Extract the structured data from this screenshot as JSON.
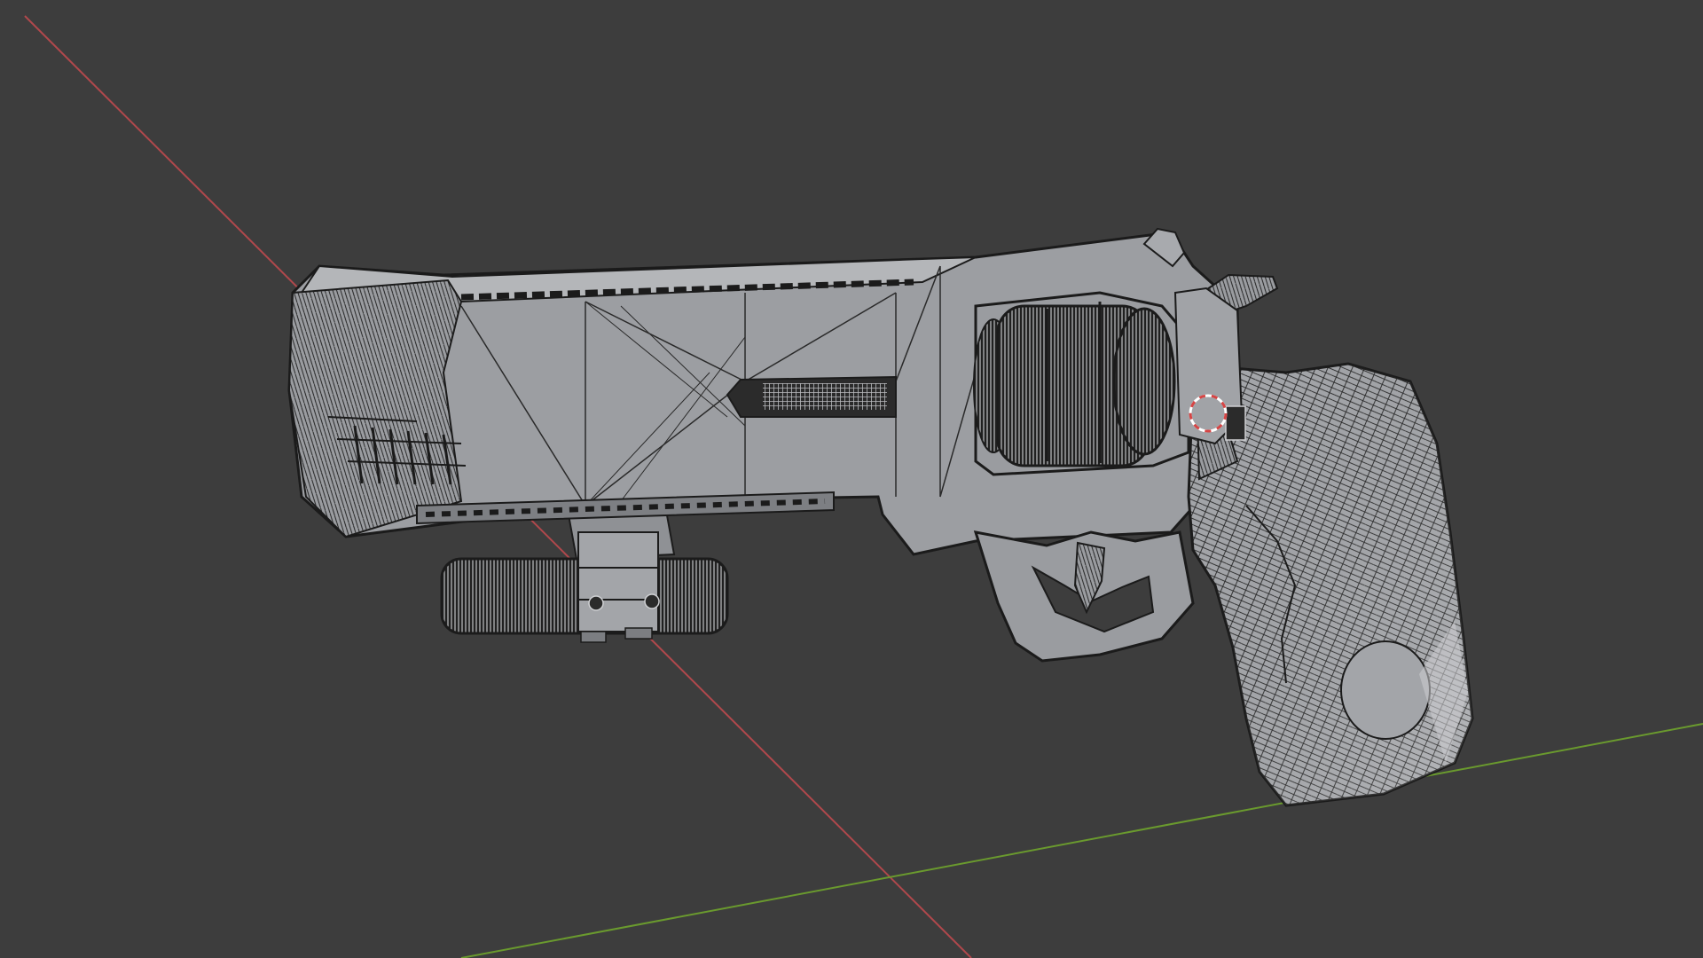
{
  "viewport": {
    "background_color": "#3d3d3d",
    "x_axis_color": "#b0484c",
    "y_axis_color": "#6a9a2e"
  },
  "model": {
    "fill_color": "#9a9ca0",
    "wire_color": "#1b1b1b",
    "highlight_color": "#d8d9dc"
  },
  "cursor_3d": {
    "ring_color": "#d64545",
    "ring_alt_color": "#ffffff"
  }
}
